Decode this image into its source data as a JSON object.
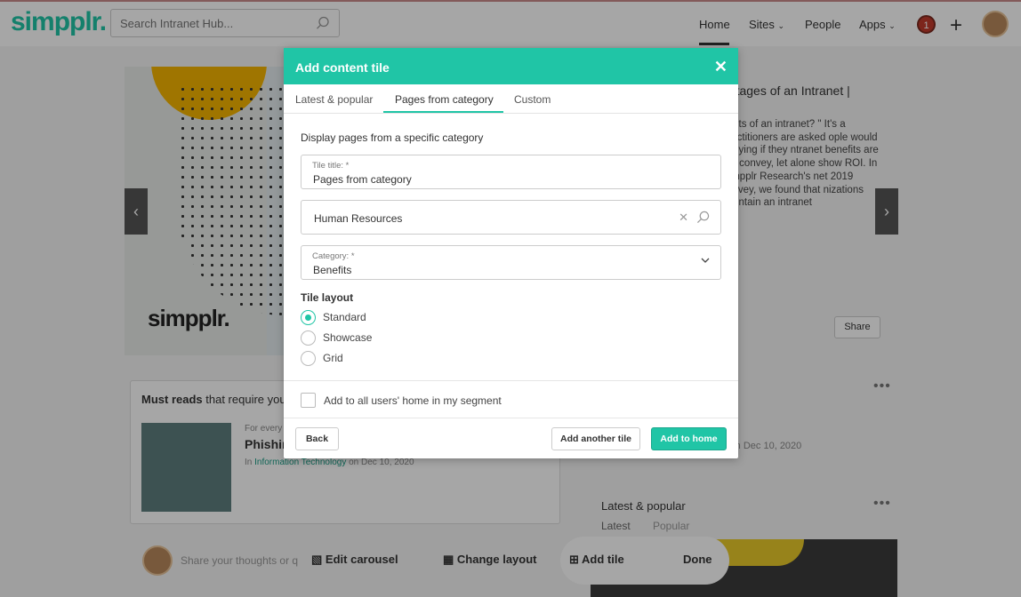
{
  "topbar": {
    "logo": "simpplr.",
    "search_placeholder": "Search Intranet Hub...",
    "nav": {
      "home": "Home",
      "sites": "Sites",
      "people": "People",
      "apps": "Apps"
    },
    "notification_count": "1"
  },
  "background": {
    "hero_logo": "simpplr.",
    "article_title": "antages of an Intranet |",
    "article_body": "nefits of an intranet? \" It's a practitioners are asked ople would be lying if they ntranet benefits are t to convey, let alone show ROI. In Simpplr Research's net 2019 Survey, we found that nizations maintain an intranet",
    "share_label": "Share",
    "must_reads_bold": "Must reads",
    "must_reads_rest": " that require your",
    "for_every": "For every",
    "phish_title": "Phishin",
    "in_prefix": "In ",
    "in_category": "Information Technology",
    "in_date": " on Dec 10, 2020",
    "mid_date": "y on Dec 10, 2020",
    "latest_popular": "Latest & popular",
    "lp_tab_latest": "Latest",
    "lp_tab_popular": "Popular",
    "share_thoughts": "Share your thoughts or q",
    "edit_carousel": "Edit carousel",
    "change_layout": "Change layout",
    "add_tile": "Add tile",
    "done": "Done"
  },
  "modal": {
    "title": "Add content tile",
    "tabs": {
      "latest": "Latest & popular",
      "pages": "Pages from category",
      "custom": "Custom"
    },
    "description": "Display pages from a specific category",
    "tile_title_label": "Tile title: *",
    "tile_title_value": "Pages from category",
    "site_value": "Human Resources",
    "category_label": "Category: *",
    "category_value": "Benefits",
    "tile_layout_label": "Tile layout",
    "layouts": {
      "standard": "Standard",
      "showcase": "Showcase",
      "grid": "Grid"
    },
    "selected_layout": "Standard",
    "add_all_label": "Add to all users' home in my segment",
    "buttons": {
      "back": "Back",
      "add_another": "Add another tile",
      "add_home": "Add to home"
    }
  },
  "colors": {
    "accent": "#20c5a6",
    "notification": "#c0392b"
  }
}
